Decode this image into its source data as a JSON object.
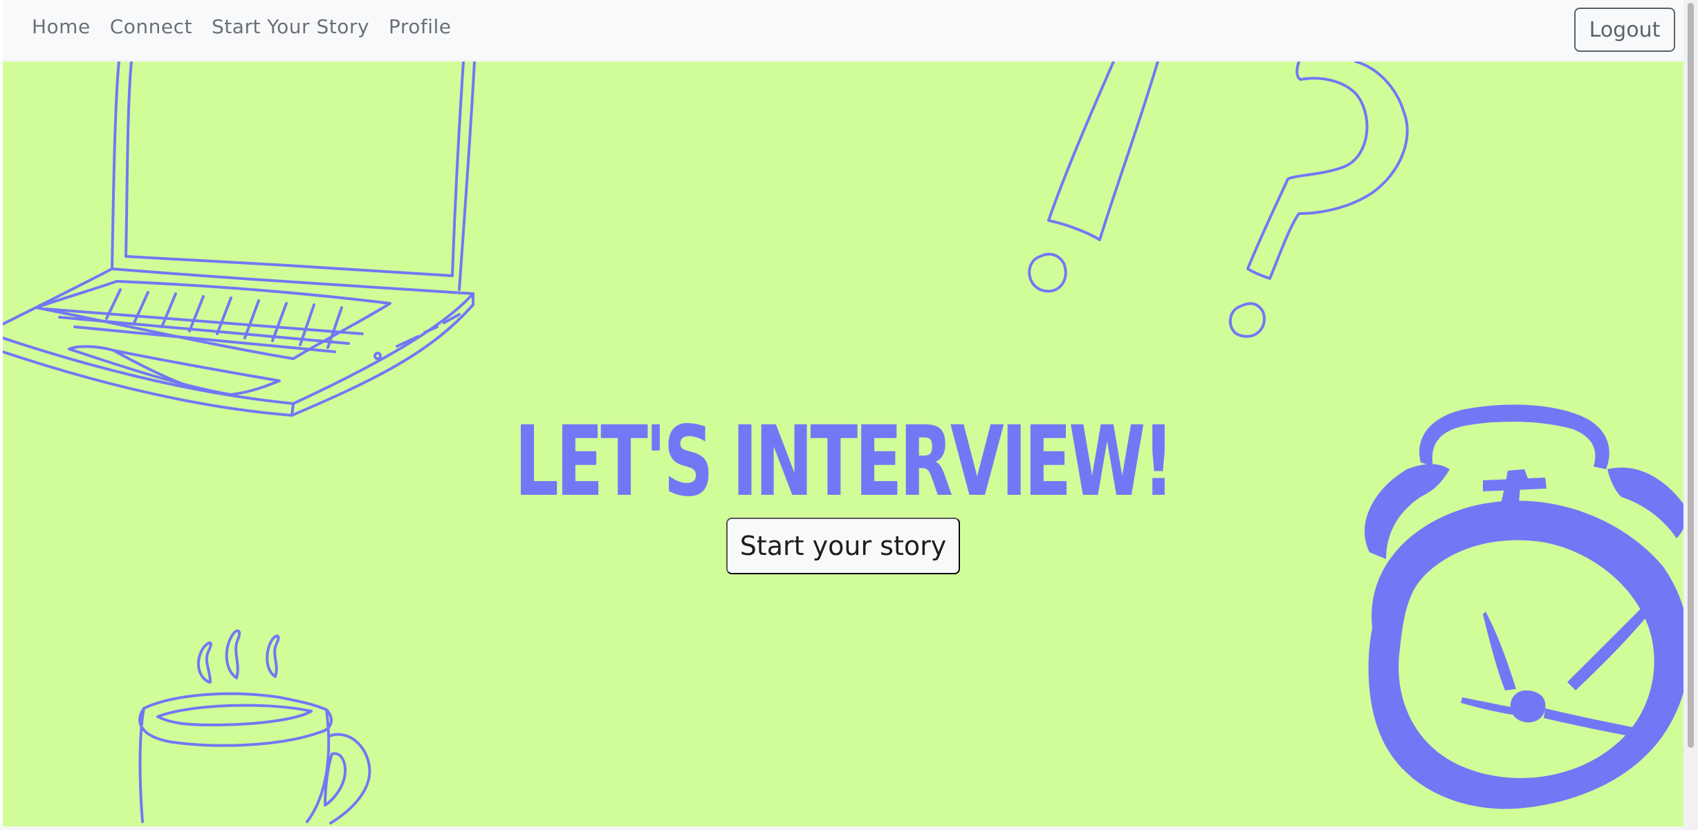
{
  "nav": {
    "links": [
      "Home",
      "Connect",
      "Start Your Story",
      "Profile"
    ],
    "logout_label": "Logout"
  },
  "hero": {
    "headline": "LET'S INTERVIEW!",
    "cta_label": "Start your story",
    "background_color": "#d1fd99",
    "accent_color": "#7377f5",
    "illustrations": [
      "laptop-illustration",
      "exclamation-question-illustration",
      "coffee-cup-illustration",
      "alarm-clock-illustration"
    ]
  }
}
